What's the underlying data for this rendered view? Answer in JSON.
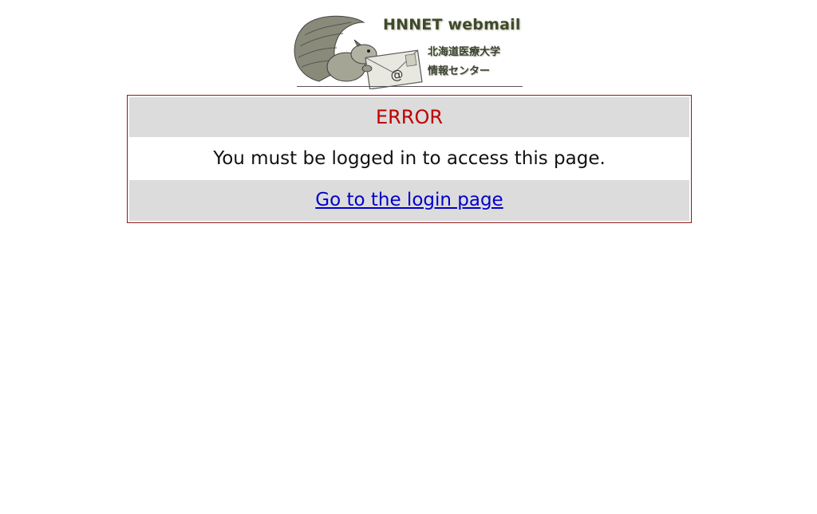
{
  "logo": {
    "title": "HNNET webmail",
    "subtitle_line1": "北海道医療大学",
    "subtitle_line2": "情報センター",
    "image_icon": "squirrel-with-envelope-logo",
    "at_symbol": "@"
  },
  "error": {
    "heading": "ERROR",
    "message": "You must be logged in to access this page.",
    "link_label": "Go to the login page"
  },
  "colors": {
    "heading": "#c00000",
    "link": "#0000cc",
    "row_bg": "#dcdcdc",
    "border": "#8b1a1a"
  }
}
